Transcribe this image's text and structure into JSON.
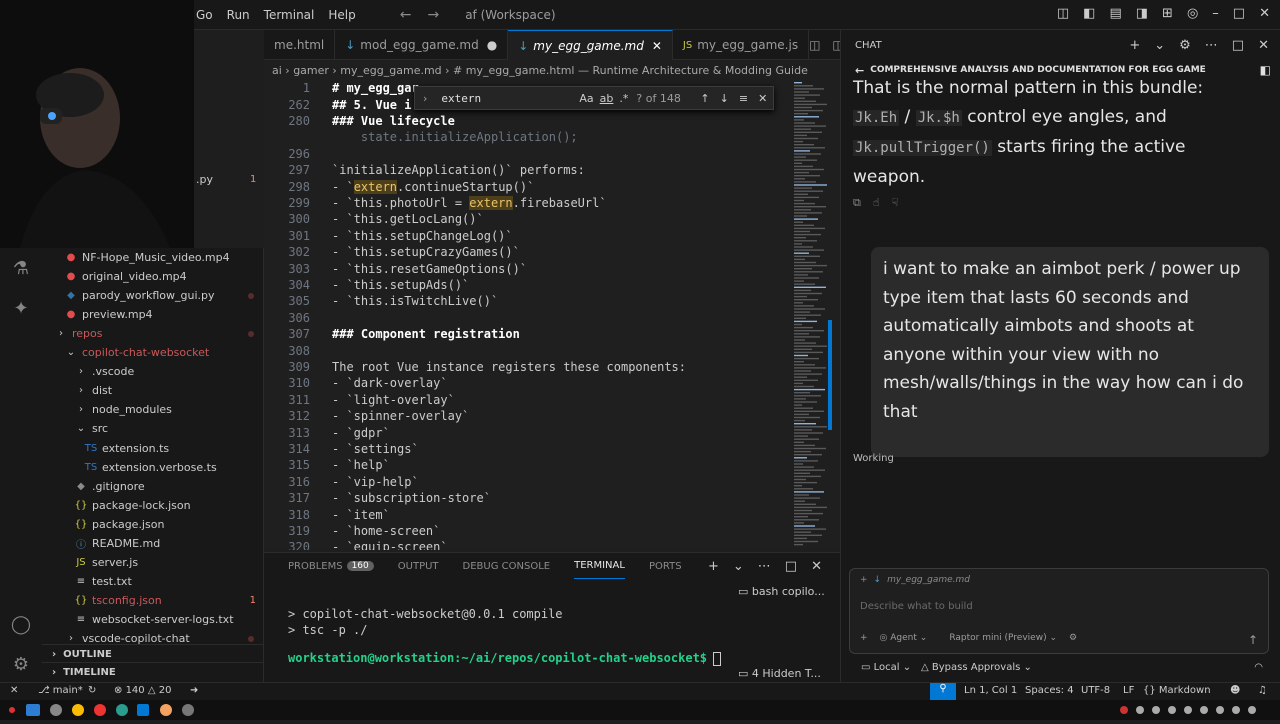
{
  "titlebar": {
    "menu": [
      "Go",
      "Run",
      "Terminal",
      "Help"
    ],
    "search": "af (Workspace)"
  },
  "editor": {
    "tabs": [
      {
        "label": "me.html",
        "active": false
      },
      {
        "label": "mod_egg_game.md",
        "active": false,
        "modified": true
      },
      {
        "label": "my_egg_game.md",
        "active": true
      },
      {
        "label": "my_egg_game.js",
        "active": false
      }
    ],
    "breadcrumb": "ai  › gamer  › my_egg_game.md  › # my_egg_game.html — Runtime Architecture & Modding Guide",
    "find": {
      "query": "extern",
      "count": "? of 148"
    },
    "lines": [
      {
        "n": "1",
        "t": "# my_egg_gar",
        "style": "h1"
      },
      {
        "n": "262",
        "t": "## 5. Vue i",
        "style": "h"
      },
      {
        "n": "280",
        "t": "### Vue lifecycle",
        "style": "h"
      },
      {
        "n": "",
        "t": "    state.initializeApplication();",
        "style": ""
      },
      {
        "n": "296",
        "t": "",
        "style": ""
      },
      {
        "n": "297",
        "t": "`initializeApplication()` performs:",
        "style": ""
      },
      {
        "n": "298",
        "t": "- `extern.continueStartup()`",
        "style": "ext1"
      },
      {
        "n": "299",
        "t": "- `this.photoUrl = extern.firebaseUrl`",
        "style": "ext2"
      },
      {
        "n": "300",
        "t": "- `this.getLocLang()`",
        "style": ""
      },
      {
        "n": "301",
        "t": "- `this.setupChangeLog()`",
        "style": ""
      },
      {
        "n": "302",
        "t": "- `this.setupCrazyGames()`",
        "style": ""
      },
      {
        "n": "303",
        "t": "- `this.resetGameOptions()`",
        "style": ""
      },
      {
        "n": "304",
        "t": "- `this.setupAds()`",
        "style": ""
      },
      {
        "n": "305",
        "t": "- `this.isTwitchLive()`",
        "style": ""
      },
      {
        "n": "306",
        "t": "",
        "style": ""
      },
      {
        "n": "307",
        "t": "### Component registration",
        "style": "h"
      },
      {
        "n": "308",
        "t": "",
        "style": ""
      },
      {
        "n": "309",
        "t": "The root Vue instance registers these components:",
        "style": ""
      },
      {
        "n": "310",
        "t": "- `dark-overlay`",
        "style": ""
      },
      {
        "n": "311",
        "t": "- `light-overlay`",
        "style": ""
      },
      {
        "n": "312",
        "t": "- `spinner-overlay`",
        "style": ""
      },
      {
        "n": "313",
        "t": "- `gdpr`",
        "style": ""
      },
      {
        "n": "314",
        "t": "- `settings`",
        "style": ""
      },
      {
        "n": "315",
        "t": "- `help`",
        "style": ""
      },
      {
        "n": "316",
        "t": "- `vip-help`",
        "style": ""
      },
      {
        "n": "317",
        "t": "- `subscription-store`",
        "style": ""
      },
      {
        "n": "318",
        "t": "- `item`",
        "style": ""
      },
      {
        "n": "319",
        "t": "- `home-screen`",
        "style": ""
      },
      {
        "n": "320",
        "t": "- `equip-screen`",
        "style": ""
      }
    ]
  },
  "sidebar": {
    "items": [
      {
        "label": "NF-Hope_Music_video.mp4",
        "icon": "video",
        "depth": 1
      },
      {
        "label": "original_video.mp4",
        "icon": "video",
        "depth": 1
      },
      {
        "label": "parody_workflow_gui.py",
        "icon": "python",
        "depth": 1,
        "status": "M"
      },
      {
        "label": "preview.mp4",
        "icon": "video",
        "depth": 1
      },
      {
        "label": "repos",
        "icon": "folder",
        "depth": 0
      },
      {
        "label": "copilot-chat-websocket",
        "icon": "folder-open",
        "depth": 1
      },
      {
        "label": ".vscode",
        "icon": "folder",
        "depth": 2
      },
      {
        "label": "dist",
        "icon": "folder",
        "depth": 2
      },
      {
        "label": "node_modules",
        "icon": "folder",
        "depth": 2
      },
      {
        "label": "src",
        "icon": "folder-open",
        "depth": 2
      },
      {
        "label": "extension.ts",
        "icon": "ts",
        "depth": 3
      },
      {
        "label": "extension.verbose.ts",
        "icon": "ts",
        "depth": 3
      },
      {
        "label": ".gitignore",
        "icon": "git",
        "depth": 2
      },
      {
        "label": "package-lock.json",
        "icon": "json",
        "depth": 2
      },
      {
        "label": "package.json",
        "icon": "json",
        "depth": 2
      },
      {
        "label": "README.md",
        "icon": "info",
        "depth": 2
      },
      {
        "label": "server.js",
        "icon": "js",
        "depth": 2
      },
      {
        "label": "test.txt",
        "icon": "txt",
        "depth": 2
      },
      {
        "label": "tsconfig.json",
        "icon": "json",
        "depth": 2,
        "status": "1"
      },
      {
        "label": "websocket-server-logs.txt",
        "icon": "txt",
        "depth": 2
      },
      {
        "label": "vscode-copilot-chat",
        "icon": "folder",
        "depth": 1
      }
    ],
    "outline": "OUTLINE",
    "timeline": "TIMELINE",
    "partial_labels": [
      ".py",
      "1"
    ]
  },
  "panel": {
    "tabs": [
      "PROBLEMS",
      "OUTPUT",
      "DEBUG CONSOLE",
      "TERMINAL",
      "PORTS"
    ],
    "problems_count": "160",
    "terminal_lines": [
      "> copilot-chat-websocket@0.0.1 compile",
      "> tsc -p ./"
    ],
    "prompt": "workstation@workstation:~/ai/repos/copilot-chat-websocket$",
    "term_name": "bash  copilo...",
    "hidden": "4 Hidden T..."
  },
  "chat": {
    "header": "CHAT",
    "title": "COMPREHENSIVE ANALYSIS AND DOCUMENTATION FOR EGG GAME",
    "answer": {
      "line1": "That is the normal pattern in this bundle:",
      "code1": "Jk.Eh",
      "sep": " / ",
      "code2": "Jk.$h",
      "rest1": " control eye angles, and",
      "code3": "Jk.pullTrigger()",
      "rest2": " starts firing the active",
      "line4": "weapon."
    },
    "user_message": "i want to make an aimbot perk / power up type item that lasts 60 seconds and automatically aimbots and shoots at anyone within your view with no mesh/walls/things in the way how can i do that",
    "status": "Working",
    "attachment": "my_egg_game.md",
    "input_placeholder": "Describe what to build",
    "mode": "Agent",
    "model": "Raptor mini (Preview)",
    "bottom": {
      "local": "Local",
      "approvals": "Bypass Approvals"
    }
  },
  "statusbar": {
    "branch": "main*",
    "errors": "140",
    "warnings": "20",
    "position": "Ln 1, Col 1",
    "spaces": "Spaces: 4",
    "encoding": "UTF-8",
    "eol": "LF",
    "language": "Markdown"
  },
  "colors": {
    "accent": "#0078d4",
    "highlight": "#4d3f1a",
    "folder_red": "#c9585b"
  }
}
